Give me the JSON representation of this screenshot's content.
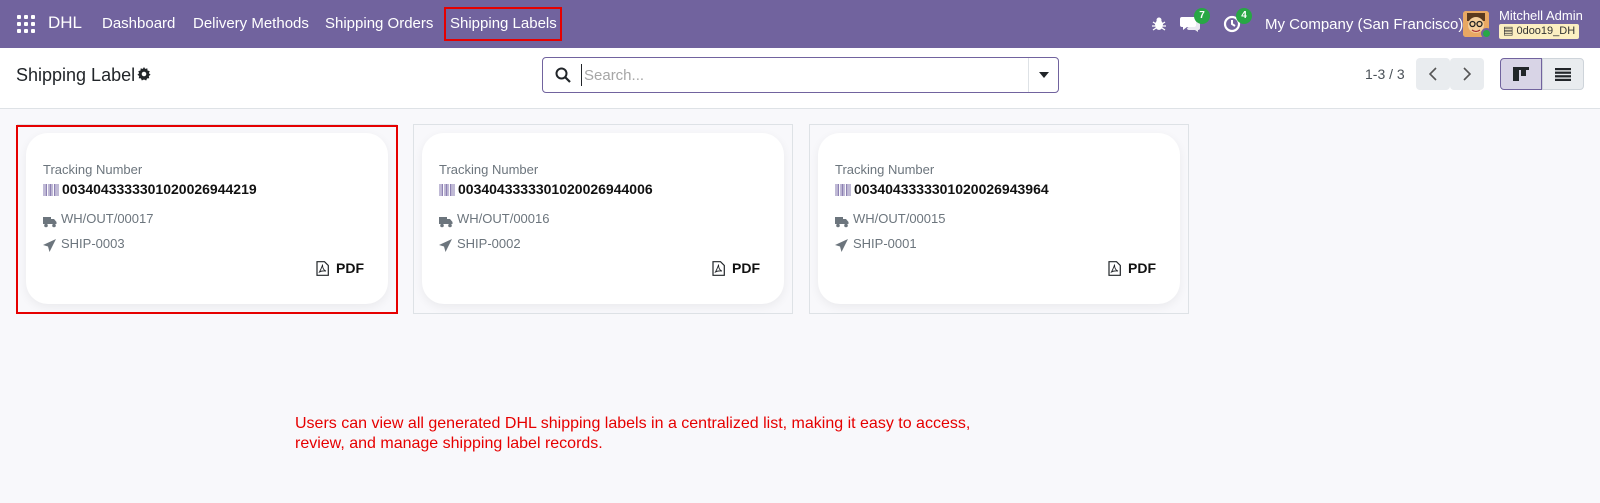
{
  "navbar": {
    "app_name": "DHL",
    "menu": [
      {
        "label": "Dashboard"
      },
      {
        "label": "Delivery Methods"
      },
      {
        "label": "Shipping Orders"
      },
      {
        "label": "Shipping Labels"
      }
    ],
    "messages_count": "7",
    "activities_count": "4",
    "company": "My Company (San Francisco)",
    "user_name": "Mitchell Admin",
    "database": "0doo19_DH"
  },
  "control_panel": {
    "title": "Shipping Label",
    "search_placeholder": "Search...",
    "pager": "1-3 / 3"
  },
  "cards": [
    {
      "tracking_label": "Tracking Number",
      "tracking_number": "00340433333010200269442‌19",
      "delivery": "WH/OUT/00017",
      "shipment": "SHIP-0003",
      "pdf_label": "PDF"
    },
    {
      "tracking_label": "Tracking Number",
      "tracking_number": "003404333330102002694400​6",
      "delivery": "WH/OUT/00016",
      "shipment": "SHIP-0002",
      "pdf_label": "PDF"
    },
    {
      "tracking_label": "Tracking Number",
      "tracking_number": "003404333330102002694396​4",
      "delivery": "WH/OUT/00015",
      "shipment": "SHIP-0001",
      "pdf_label": "PDF"
    }
  ],
  "caption": "Users can view all generated DHL shipping labels in a centralized list, making it easy to access, review, and manage shipping label records.",
  "colors": {
    "navbar": "#71639e",
    "highlight": "#e60000",
    "badge": "#28a745"
  }
}
